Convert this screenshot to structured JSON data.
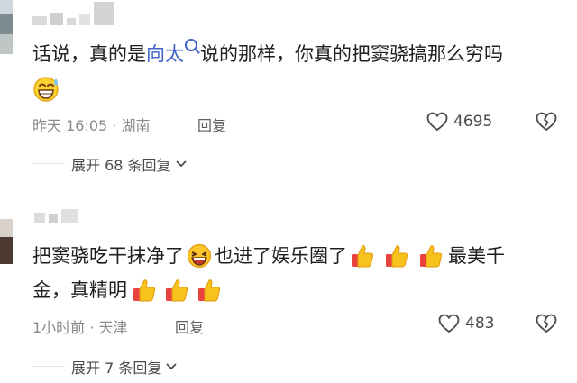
{
  "comments": [
    {
      "text_before": "话说，真的是",
      "highlight": "向太",
      "text_after": "说的那样，你真的把窦骁搞那么穷吗",
      "time": "昨天 16:05",
      "location": "湖南",
      "reply_label": "回复",
      "likes": "4695",
      "expand_label": "展开 68 条回复"
    },
    {
      "line1_part1": "把窦骁吃干抹净了",
      "line1_part2": "也进了娱乐圈了",
      "line1_part3": "最美千",
      "line2": "金，真精明",
      "time": "1小时前",
      "location": "天津",
      "reply_label": "回复",
      "likes": "483",
      "expand_label": "展开 7 条回复"
    }
  ],
  "icons": {
    "search": "search-icon",
    "heart": "heart-icon",
    "broken_heart": "broken-heart-icon",
    "chevron": "chevron-down-icon",
    "thumbs_up": "thumbs-up-emoji",
    "grin": "grin-sweat-emoji",
    "laugh": "laughing-emoji"
  },
  "colors": {
    "highlight_link": "#3f63c8",
    "meta_gray": "#8a8a8a",
    "thumb_yellow": "#f7c21c",
    "thumb_sleeve": "#e8433d"
  }
}
